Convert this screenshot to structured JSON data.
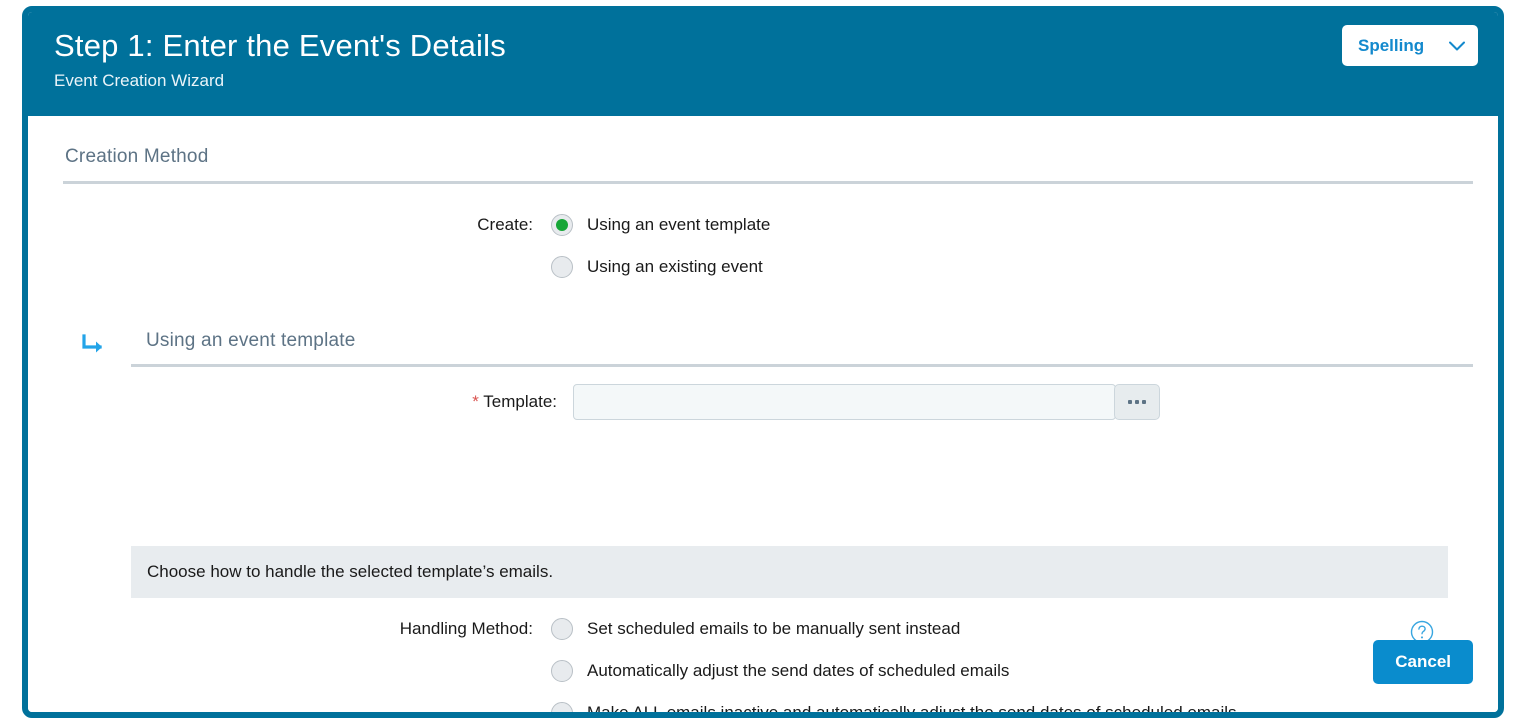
{
  "header": {
    "title": "Step 1: Enter the Event's Details",
    "subtitle": "Event Creation Wizard",
    "spelling_label": "Spelling",
    "chevron_icon": "chevron-down-icon",
    "bg_color": "#00719b"
  },
  "creation_method": {
    "section_title": "Creation Method",
    "create_label": "Create:",
    "options": [
      {
        "label": "Using an event template",
        "selected": true
      },
      {
        "label": "Using an existing event",
        "selected": false
      }
    ]
  },
  "template_section": {
    "arrow_icon": "arrow-turn-down-right-icon",
    "section_title": "Using an event template",
    "required_marker": "*",
    "template_label": "Template:",
    "template_value": "",
    "template_placeholder": "",
    "browse_button_icon": "ellipsis-icon",
    "browse_button_label": "...",
    "highlight_color": "#000000"
  },
  "info_band": {
    "text": "Choose how to handle the selected template’s emails.",
    "bg_color": "#e8ecef"
  },
  "handling_method": {
    "label": "Handling Method:",
    "help_icon": "help-circle-icon",
    "options": [
      {
        "label": "Set scheduled emails to be manually sent instead",
        "selected": false
      },
      {
        "label": "Automatically adjust the send dates of scheduled emails",
        "selected": false
      },
      {
        "label": "Make ALL emails inactive and automatically adjust the send dates of scheduled emails",
        "selected": false
      }
    ]
  },
  "footer": {
    "cancel_label": "Cancel",
    "cancel_color": "#0a8ccd"
  }
}
